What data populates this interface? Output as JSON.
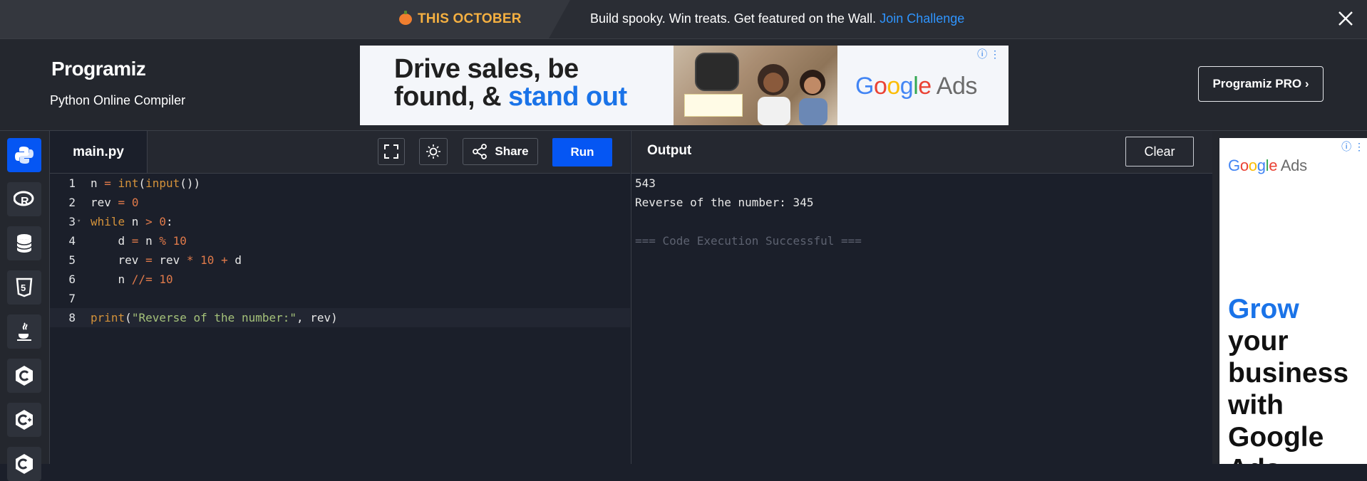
{
  "promo": {
    "badge": "THIS OCTOBER",
    "message": "Build spooky. Win treats. Get featured on the Wall.",
    "link": "Join Challenge",
    "close_icon": "close-icon"
  },
  "header": {
    "logo": "Programiz",
    "subtitle": "Python Online Compiler",
    "pro_button": "Programiz PRO ›"
  },
  "ad_banner": {
    "headline_line1": "Drive sales, be",
    "headline_line2_start": "found, & ",
    "headline_line2_accent": "stand out",
    "brand_g": "G",
    "brand_o1": "o",
    "brand_o2": "o",
    "brand_g2": "g",
    "brand_l": "l",
    "brand_e": "e",
    "brand_ads": " Ads",
    "info": "ⓘ ⋮"
  },
  "rail": {
    "items": [
      {
        "name": "python",
        "glyph": "🐍"
      },
      {
        "name": "r",
        "glyph": "R"
      },
      {
        "name": "sql",
        "glyph": "≡"
      },
      {
        "name": "html",
        "glyph": "5"
      },
      {
        "name": "java",
        "glyph": "♨"
      },
      {
        "name": "c",
        "glyph": "C"
      },
      {
        "name": "cpp",
        "glyph": "C"
      },
      {
        "name": "csharp",
        "glyph": "C"
      }
    ]
  },
  "editor": {
    "file_tab": "main.py",
    "share_label": "Share",
    "run_label": "Run",
    "lines": [
      {
        "n": "1"
      },
      {
        "n": "2"
      },
      {
        "n": "3"
      },
      {
        "n": "4"
      },
      {
        "n": "5"
      },
      {
        "n": "6"
      },
      {
        "n": "7"
      },
      {
        "n": "8"
      }
    ],
    "code": {
      "l1_a": "n ",
      "l1_op": "=",
      "l1_b": " ",
      "l1_fn": "int",
      "l1_c": "(",
      "l1_fn2": "input",
      "l1_d": "())",
      "l2_a": "rev ",
      "l2_op": "=",
      "l2_sp": " ",
      "l2_num": "0",
      "l3_kw": "while",
      "l3_a": " n ",
      "l3_op": ">",
      "l3_sp": " ",
      "l3_num": "0",
      "l3_b": ":",
      "l4_a": "    d ",
      "l4_op": "=",
      "l4_b": " n ",
      "l4_op2": "%",
      "l4_sp": " ",
      "l4_num": "10",
      "l5_a": "    rev ",
      "l5_op": "=",
      "l5_b": " rev ",
      "l5_op2": "*",
      "l5_sp": " ",
      "l5_num": "10",
      "l5_c": " ",
      "l5_op3": "+",
      "l5_d": " d",
      "l6_a": "    n ",
      "l6_op": "//=",
      "l6_sp": " ",
      "l6_num": "10",
      "l8_fn": "print",
      "l8_a": "(",
      "l8_str": "\"Reverse of the number:\"",
      "l8_b": ", rev)"
    }
  },
  "output": {
    "title": "Output",
    "clear_label": "Clear",
    "lines": [
      "543",
      "Reverse of the number: 345",
      "",
      "=== Code Execution Successful ==="
    ]
  },
  "side_ad": {
    "brand_ads": " Ads",
    "text_accent": "Grow",
    "text_rest": "your business with Google Ads",
    "info": "ⓘ ⋮"
  }
}
